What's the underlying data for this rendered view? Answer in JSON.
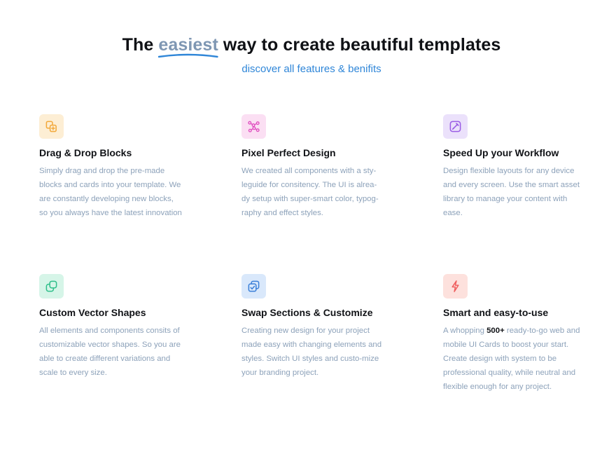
{
  "header": {
    "title_before": "The",
    "title_highlight": "easiest",
    "title_after": "way to create beautiful templates",
    "subtitle": "discover all features & benifits"
  },
  "colors": {
    "heading": "#0f1115",
    "highlight": "#7f97b3",
    "underline": "#2f86d8",
    "subtitle": "#2f86d8",
    "body_text": "#8da2ba"
  },
  "features": [
    {
      "icon": "drag-drop-icon",
      "icon_color": "#f2a93b",
      "icon_bg": "#fdeed4",
      "title": "Drag & Drop Blocks",
      "description": "Simply drag and drop the pre-made blocks and cards into your template. We are constantly developing new blocks, so you always have the latest innovation"
    },
    {
      "icon": "vector-nodes-icon",
      "icon_color": "#e04fc0",
      "icon_bg": "#fbdff3",
      "title": "Pixel Perfect Design",
      "description": "We created all components with a sty-leguide for consitency. The UI is alrea-dy setup with super-smart color, typog-raphy and effect styles."
    },
    {
      "icon": "pen-tool-icon",
      "icon_color": "#9b5de5",
      "icon_bg": "#ebe1fb",
      "title": "Speed Up your Workflow",
      "description": "Design flexible layouts for any device and every screen. Use the smart asset library to manage your content with ease."
    },
    {
      "icon": "vector-shapes-icon",
      "icon_color": "#2fbf8a",
      "icon_bg": "#d6f5e8",
      "title": "Custom Vector Shapes",
      "description": "All elements and components consits of customizable vector shapes. So you are able to create different variations and scale to every size."
    },
    {
      "icon": "swap-sections-icon",
      "icon_color": "#3a7fd8",
      "icon_bg": "#d9e8fb",
      "title": "Swap Sections & Customize",
      "description": "Creating new design for your project made easy with changing elements and styles. Switch UI styles and custo-mize your branding project."
    },
    {
      "icon": "lightning-icon",
      "icon_color": "#ef5f5f",
      "icon_bg": "#fde1dd",
      "title": "Smart and easy-to-use",
      "description_before": "A whopping",
      "description_strong": "500+",
      "description_after": "ready-to-go web and mobile UI Cards to boost your start. Create design with system to be professional quality, while neutral and flexible enough for any project."
    }
  ]
}
